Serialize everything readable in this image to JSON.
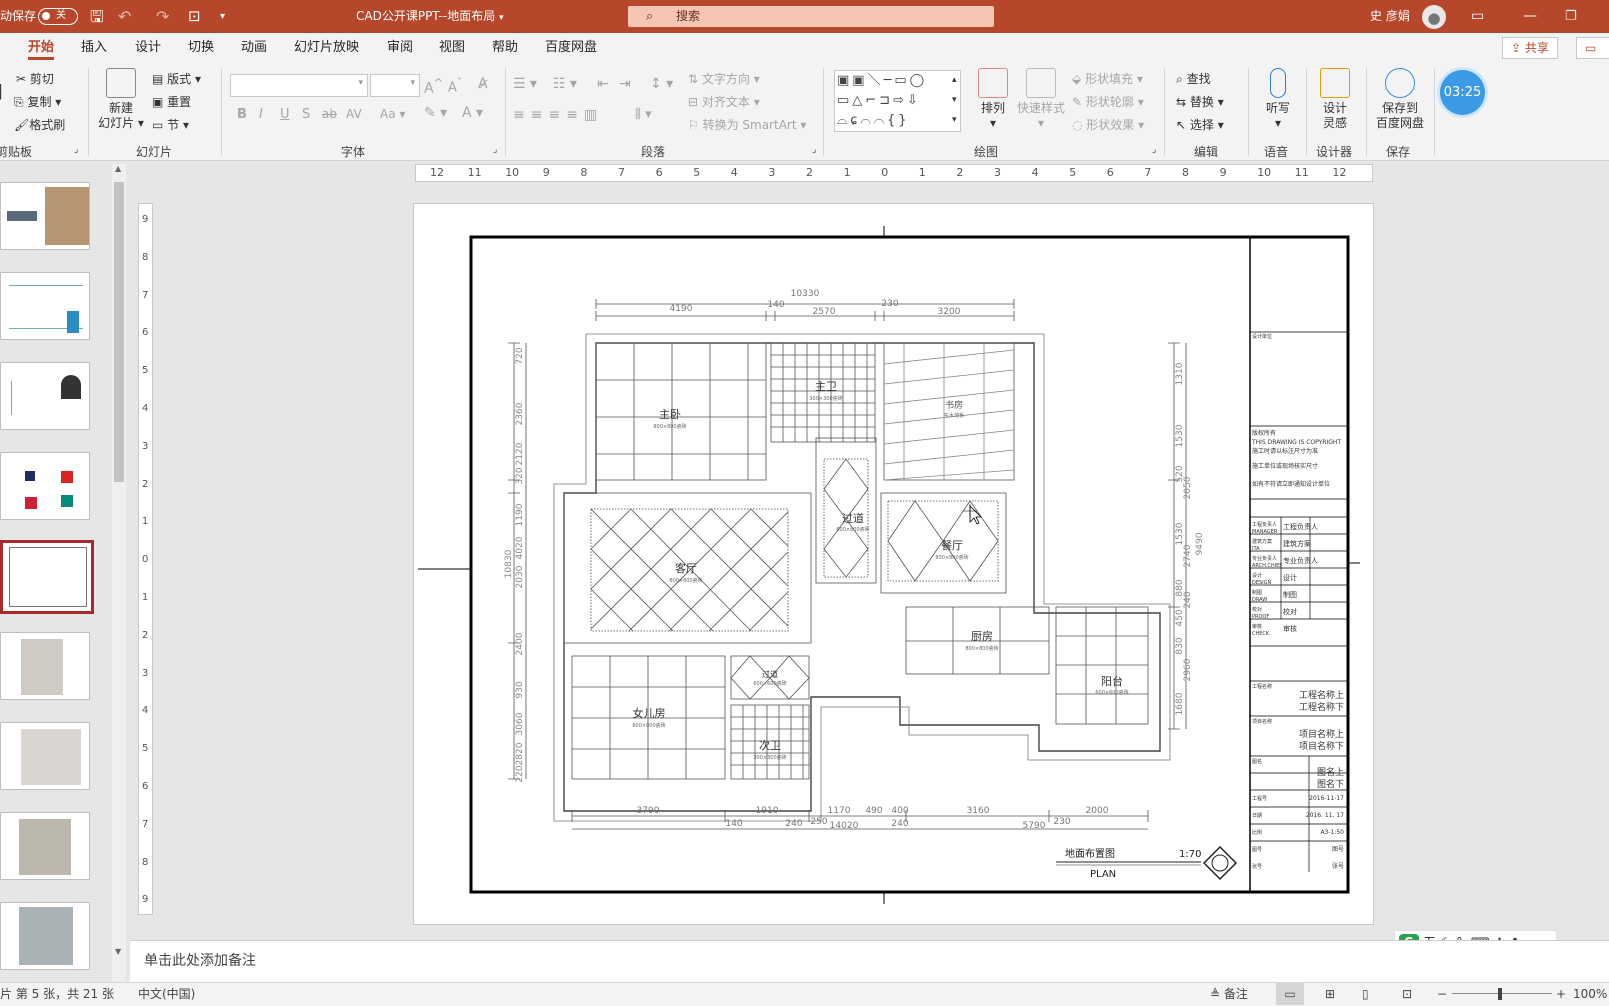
{
  "titlebar": {
    "autosave": "动保存",
    "toggle_state": "关",
    "doc_title": "CAD公开课PPT--地面布局",
    "search_placeholder": "搜索",
    "user_name": "史 彦娟"
  },
  "tabs": [
    "开始",
    "插入",
    "设计",
    "切换",
    "动画",
    "幻灯片放映",
    "审阅",
    "视图",
    "帮助",
    "百度网盘"
  ],
  "share": {
    "share_label": "共享",
    "comment_label": "批注"
  },
  "ribbon": {
    "clipboard": {
      "cut": "剪切",
      "copy": "复制",
      "format_painter": "格式刷",
      "label": "剪贴板"
    },
    "slides": {
      "new_slide": "新建",
      "new_slide2": "幻灯片",
      "layout": "版式",
      "reset": "重置",
      "section": "节",
      "label": "幻灯片"
    },
    "font": {
      "label": "字体"
    },
    "paragraph": {
      "text_direction": "文字方向",
      "align_text": "对齐文本",
      "smartart": "转换为 SmartArt",
      "label": "段落"
    },
    "drawing": {
      "arrange": "排列",
      "quick_styles": "快速样式",
      "shape_fill": "形状填充",
      "shape_outline": "形状轮廓",
      "shape_effects": "形状效果",
      "label": "绘图"
    },
    "editing": {
      "find": "查找",
      "replace": "替换",
      "select": "选择",
      "label": "编辑"
    },
    "voice": {
      "dictate": "听写",
      "label": "语音"
    },
    "designer": {
      "design": "设计",
      "design2": "灵感",
      "label": "设计器"
    },
    "save": {
      "save_to": "保存到",
      "save_to2": "百度网盘",
      "label": "保存"
    },
    "timer": "03:25"
  },
  "ruler_h": [
    "12",
    "11",
    "10",
    "9",
    "8",
    "7",
    "6",
    "5",
    "4",
    "3",
    "2",
    "1",
    "0",
    "1",
    "2",
    "3",
    "4",
    "5",
    "6",
    "7",
    "8",
    "9",
    "10",
    "11",
    "12"
  ],
  "ruler_v": [
    "9",
    "8",
    "7",
    "6",
    "5",
    "4",
    "3",
    "2",
    "1",
    "0",
    "1",
    "2",
    "3",
    "4",
    "5",
    "6",
    "7",
    "8",
    "9"
  ],
  "plan": {
    "dims_top": [
      "10330",
      "4190",
      "140",
      "2570",
      "230",
      "3200"
    ],
    "dims_bottom": [
      "3790",
      "1910",
      "1170",
      "490",
      "400",
      "3160",
      "2000",
      "140",
      "240",
      "250",
      "14020",
      "240",
      "5790",
      "230"
    ],
    "dims_left": [
      "720",
      "2360",
      "2120",
      "320",
      "1190",
      "4020",
      "2030",
      "10830",
      "2400",
      "930",
      "3060",
      "2820",
      "220"
    ],
    "dims_right": [
      "1310",
      "1530",
      "520",
      "2050",
      "1530",
      "2740",
      "9490",
      "880",
      "240",
      "450",
      "830",
      "2960",
      "1680"
    ],
    "rooms": [
      {
        "name": "主卧",
        "note": "800×800瓷砖"
      },
      {
        "name": "主卫",
        "note": "300×300瓷砖"
      },
      {
        "name": "书房",
        "note": "实木地板"
      },
      {
        "name": "过道",
        "note": "800×800瓷砖"
      },
      {
        "name": "客厅",
        "note": "800×800瓷砖"
      },
      {
        "name": "餐厅",
        "note": "800×800瓷砖"
      },
      {
        "name": "厨房",
        "note": "800×800瓷砖"
      },
      {
        "name": "阳台",
        "note": "600×600瓷砖"
      },
      {
        "name": "女儿房",
        "note": "800×800瓷砖"
      },
      {
        "name": "过道",
        "note": "600×600瓷砖"
      },
      {
        "name": "次卫",
        "note": "300×300瓷砖"
      }
    ],
    "drawing_title": "地面布置图",
    "drawing_subtitle": "PLAN",
    "scale": "1:70"
  },
  "titleblock": {
    "designer_label": "设计单位",
    "copyright": [
      "版权所有",
      "THIS DRAWING IS COPYRIGHT",
      "施工时请以标注尺寸为准",
      "施工单位或现场核实尺寸",
      "如有不符请立即通知设计单位"
    ],
    "roles": [
      {
        "label": "工程负责人",
        "sub": "MANAGER",
        "value": "工程负责人"
      },
      {
        "label": "建筑方案",
        "sub": "ITA",
        "value": "建筑方案"
      },
      {
        "label": "专业负责人",
        "sub": "ARCH.CHIEF",
        "value": "专业负责人"
      },
      {
        "label": "设计",
        "sub": "DESIGN",
        "value": "设计"
      },
      {
        "label": "制图",
        "sub": "DRAW",
        "value": "制图"
      },
      {
        "label": "校对",
        "sub": "PROOF",
        "value": "校对"
      },
      {
        "label": "审核",
        "sub": "CHECK",
        "value": "审核"
      }
    ],
    "project_label": "工程名称",
    "project_values": [
      "工程名称上",
      "工程名称下"
    ],
    "item_label": "项目名称",
    "item_values": [
      "项目名称上",
      "项目名称下"
    ],
    "title_label": "图名",
    "title_values": [
      "图名上",
      "图名下"
    ],
    "meta": [
      {
        "label": "工程号",
        "value": "2016-11-17"
      },
      {
        "label": "日期",
        "value": "2016. 11. 17"
      },
      {
        "label": "比例",
        "value": "A3-1:50"
      },
      {
        "label": "图号",
        "value": "图号"
      },
      {
        "label": "张号",
        "value": "张号"
      }
    ]
  },
  "notes_placeholder": "单击此处添加备注",
  "status": {
    "slide_info": "片 第 5 张，共 21 张",
    "language": "中文(中国)",
    "notes": "备注",
    "zoom": "100%"
  },
  "ime": {
    "label": "五"
  }
}
